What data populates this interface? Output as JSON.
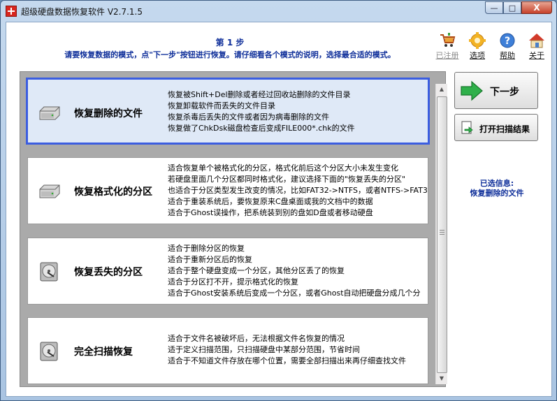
{
  "window": {
    "title": "超级硬盘数据恢复软件 V2.7.1.5",
    "controls": {
      "minimize": "—",
      "maximize": "□",
      "close": "X"
    }
  },
  "header": {
    "step_title": "第 1 步",
    "step_desc": "请要恢复数据的模式，点\"下一步\"按钮进行恢复。请仔细看各个模式的说明，选择最合适的模式。"
  },
  "toolbar": {
    "register": {
      "label": "已注册",
      "icon": "cart-icon",
      "enabled": false
    },
    "options": {
      "label": "选项",
      "icon": "gear-icon"
    },
    "help": {
      "label": "帮助",
      "icon": "help-icon"
    },
    "about": {
      "label": "关于",
      "icon": "home-icon"
    }
  },
  "modes": [
    {
      "name": "恢复删除的文件",
      "icon": "drive-icon",
      "selected": true,
      "desc": [
        "恢复被Shift+Del删除或者经过回收站删除的文件目录",
        "恢复卸载软件而丢失的文件目录",
        "恢复杀毒后丢失的文件或者因为病毒删除的文件",
        "恢复做了ChkDsk磁盘检查后变成FILE000*.chk的文件"
      ]
    },
    {
      "name": "恢复格式化的分区",
      "icon": "drive-icon",
      "selected": false,
      "desc": [
        "适合恢复单个被格式化的分区，格式化前后这个分区大小未发生变化",
        "若硬盘里面几个分区都同时格式化，建议选择下面的\"恢复丢失的分区\"",
        "也适合于分区类型发生改变的情况，比如FAT32->NTFS，或者NTFS->FAT3",
        "适合于重装系统后，要恢复原来C盘桌面或我的文档中的数据",
        "适合于Ghost误操作，把系统装到别的盘如D盘或者移动硬盘"
      ]
    },
    {
      "name": "恢复丢失的分区",
      "icon": "disk-platter-icon",
      "selected": false,
      "desc": [
        "适合于删除分区的恢复",
        "适合于重新分区后的恢复",
        "适合于整个硬盘变成一个分区，其他分区丢了的恢复",
        "适合于分区打不开，提示格式化的恢复",
        "适合于Ghost安装系统后变成一个分区，或者Ghost自动把硬盘分成几个分"
      ]
    },
    {
      "name": "完全扫描恢复",
      "icon": "disk-platter-icon",
      "selected": false,
      "desc": [
        "适合于文件名被破坏后，无法根据文件名恢复的情况",
        "适于定义扫描范围，只扫描硬盘中某部分范围，节省时间",
        "适合于不知道文件存放在哪个位置，需要全部扫描出来再仔细查找文件"
      ]
    }
  ],
  "buttons": {
    "next": "下一步",
    "open_scan": "打开扫描结果"
  },
  "selection": {
    "label": "已选信息:",
    "value": "恢复删除的文件"
  },
  "colors": {
    "accent": "#0f2f9a",
    "selection_border": "#3b5de0",
    "list_bg": "#aaaaaa"
  }
}
